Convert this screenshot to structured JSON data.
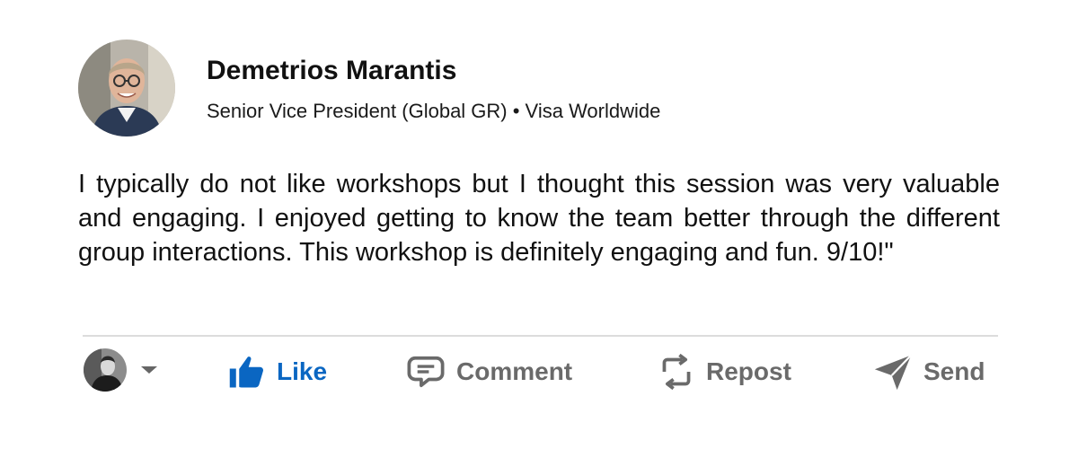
{
  "author": {
    "name": "Demetrios Marantis",
    "headline": "Senior Vice President (Global GR) • Visa Worldwide"
  },
  "post": {
    "text": "I typically do not like workshops but I thought this session was very valuable and engaging. I enjoyed getting to know the team better through the different group interactions. This workshop is definitely engaging and fun. 9/10!\""
  },
  "actions": {
    "like": {
      "label": "Like",
      "icon": "thumbs-up-icon",
      "color": "#0a66c2"
    },
    "comment": {
      "label": "Comment",
      "icon": "comment-icon",
      "color": "#6a6a6a"
    },
    "repost": {
      "label": "Repost",
      "icon": "repost-icon",
      "color": "#6a6a6a"
    },
    "send": {
      "label": "Send",
      "icon": "send-icon",
      "color": "#6a6a6a"
    }
  },
  "colors": {
    "accent": "#0a66c2",
    "text": "#111111",
    "muted": "#6a6a6a",
    "divider": "#dcdcdc"
  }
}
